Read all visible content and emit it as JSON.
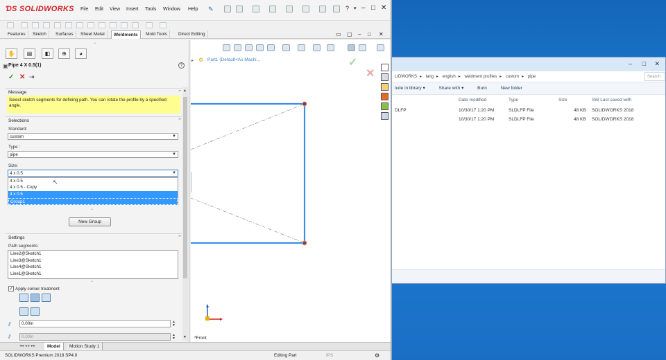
{
  "app": {
    "brand": "SOLIDWORKS",
    "menus": [
      "File",
      "Edit",
      "View",
      "Insert",
      "Tools",
      "Window",
      "Help"
    ],
    "window_controls": [
      "–",
      "□",
      "✕"
    ]
  },
  "command_tabs": [
    "Features",
    "Sketch",
    "Surfaces",
    "Sheet Metal",
    "Weldments",
    "Mold Tools",
    "Direct Editing"
  ],
  "active_command_tab": "Weldments",
  "property_manager": {
    "title": "Pipe 4 X 0.5(1)",
    "help": "?",
    "message_header": "Message",
    "message_text": "Select sketch segments for defining path. You can rotate the profile by a specified angle.",
    "selections_header": "Selections",
    "standard_label": "Standard:",
    "standard_value": "custom",
    "type_label": "Type :",
    "type_value": "pipe",
    "size_label": "Size:",
    "size_value": "4 x 0.5",
    "size_options": [
      "4 x 0.5",
      "4 x 0.5 - Copy",
      "4 x 0.5",
      "Group1"
    ],
    "new_group_button": "New Group",
    "settings_header": "Settings",
    "path_segments_label": "Path segments:",
    "path_segments": [
      "Line2@Sketch1",
      "Line3@Sketch1",
      "Line4@Sketch1",
      "Line1@Sketch1"
    ],
    "corner_treatment_label": "Apply corner treatment",
    "corner_treatment_checked": true,
    "gap_value_1": "0.00in",
    "gap_value_2": "0.00in"
  },
  "graphics": {
    "tree_item": "Part1 (Default<As Machi...",
    "view_label": "*Front"
  },
  "bottom_tabs": [
    "Model",
    "Motion Study 1"
  ],
  "status_bar": {
    "product": "SOLIDWORKS Premium 2018 SP4.0",
    "mode": "Editing Part",
    "units": "IPS"
  },
  "explorer": {
    "breadcrumbs": [
      "LIDWORKS",
      "lang",
      "english",
      "weldment profiles",
      "custom",
      "pipe"
    ],
    "search_placeholder": "Search",
    "toolbar": [
      "lude in library ▾",
      "Share with ▾",
      "Burn",
      "New folder"
    ],
    "columns": [
      "Date modified",
      "Type",
      "Size",
      "SW Last saved with"
    ],
    "rows": [
      {
        "name": "DLFP",
        "date": "10/30/17 1:20 PM",
        "type": "SLDLFP File",
        "size": "48 KB",
        "saved": "SOLIDWORKS 2018"
      },
      {
        "name": "",
        "date": "10/30/17 1:20 PM",
        "type": "SLDLFP File",
        "size": "48 KB",
        "saved": "SOLIDWORKS 2018"
      }
    ]
  },
  "colors": {
    "sketch_blue": "#3b8fe6",
    "endpoint": "#7b2cbf",
    "message_bg": "#fefe90",
    "selection": "#3399ff",
    "desktop": "#1a6fc4"
  }
}
